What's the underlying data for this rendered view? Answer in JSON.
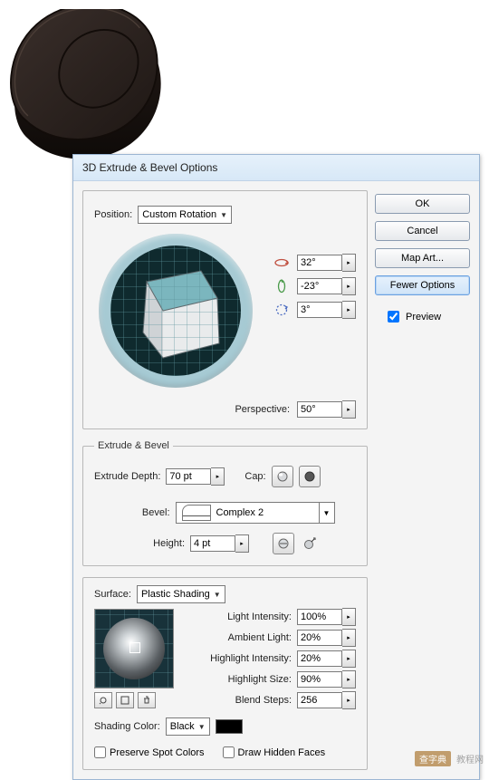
{
  "dialog": {
    "title": "3D Extrude & Bevel Options"
  },
  "buttons": {
    "ok": "OK",
    "cancel": "Cancel",
    "map_art": "Map Art...",
    "fewer_options": "Fewer Options",
    "preview_label": "Preview"
  },
  "position": {
    "group_label": "Position:",
    "mode": "Custom Rotation",
    "rot_x": "32°",
    "rot_y": "-23°",
    "rot_z": "3°",
    "perspective_label": "Perspective:",
    "perspective": "50°"
  },
  "extrude_bevel": {
    "group_label": "Extrude & Bevel",
    "depth_label": "Extrude Depth:",
    "depth": "70 pt",
    "cap_label": "Cap:",
    "bevel_label": "Bevel:",
    "bevel": "Complex 2",
    "height_label": "Height:",
    "height": "4 pt"
  },
  "surface": {
    "group_label": "Surface:",
    "mode": "Plastic Shading",
    "light_intensity_label": "Light Intensity:",
    "light_intensity": "100%",
    "ambient_light_label": "Ambient Light:",
    "ambient_light": "20%",
    "highlight_intensity_label": "Highlight Intensity:",
    "highlight_intensity": "20%",
    "highlight_size_label": "Highlight Size:",
    "highlight_size": "90%",
    "blend_steps_label": "Blend Steps:",
    "blend_steps": "256",
    "shading_color_label": "Shading Color:",
    "shading_color": "Black",
    "preserve_spot_label": "Preserve Spot Colors",
    "draw_hidden_label": "Draw Hidden Faces"
  },
  "watermark": {
    "badge": "查字典",
    "site": "教程网"
  }
}
